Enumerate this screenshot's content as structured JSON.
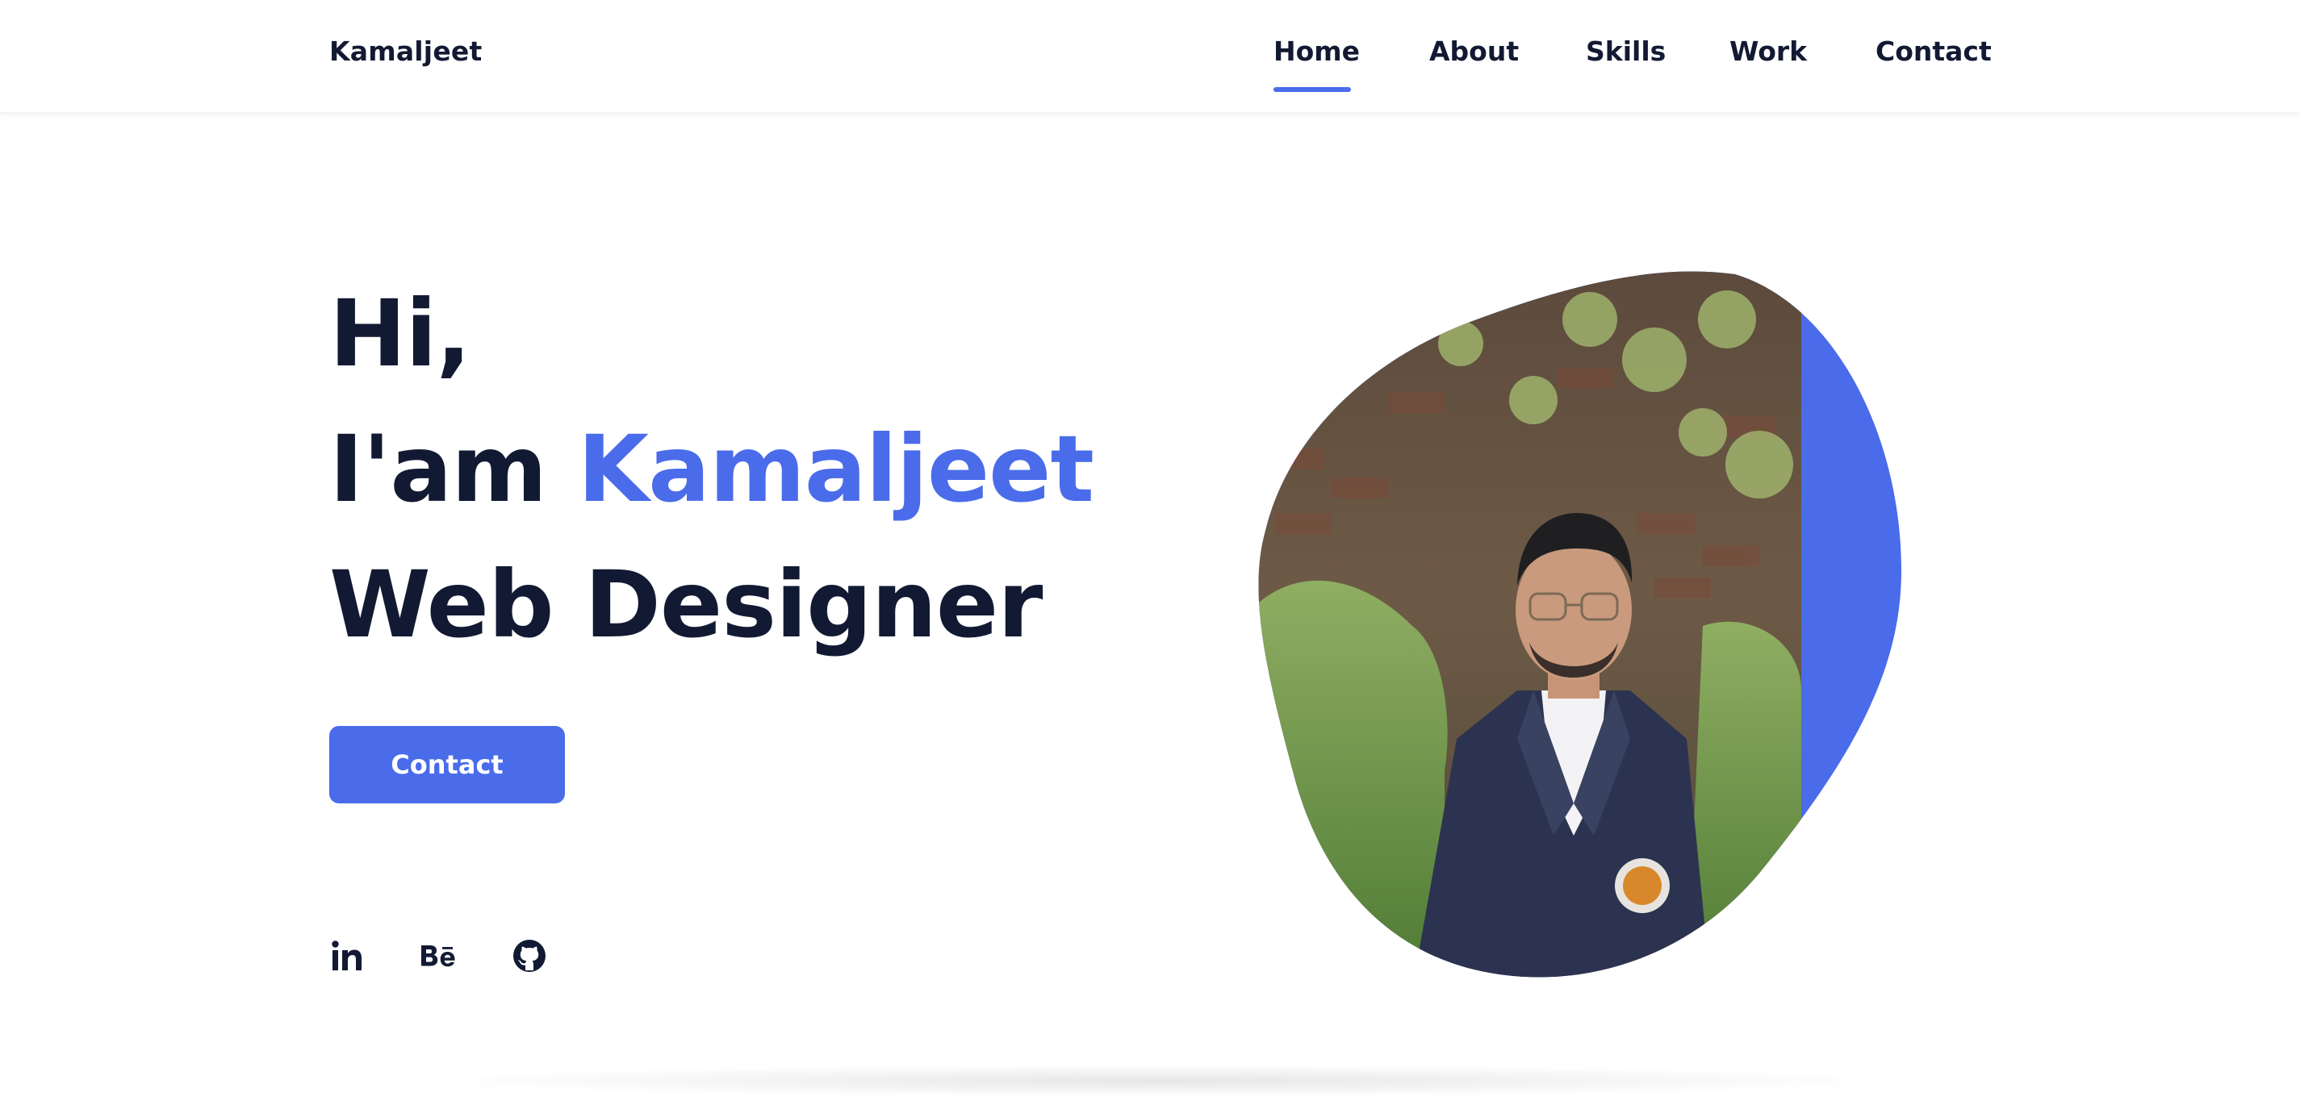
{
  "brand": {
    "name": "Kamaljeet"
  },
  "nav": {
    "items": [
      {
        "label": "Home",
        "active": true
      },
      {
        "label": "About",
        "active": false
      },
      {
        "label": "Skills",
        "active": false
      },
      {
        "label": "Work",
        "active": false
      },
      {
        "label": "Contact",
        "active": false
      }
    ]
  },
  "hero": {
    "greeting": "Hi,",
    "intro_prefix": "I'am ",
    "name": "Kamaljeet",
    "role": "Web Designer",
    "cta_label": "Contact"
  },
  "socials": [
    {
      "icon": "linkedin-icon",
      "label": "in"
    },
    {
      "icon": "behance-icon",
      "label": "Bē"
    },
    {
      "icon": "github-icon"
    }
  ],
  "colors": {
    "accent": "#4a6cea",
    "text": "#121a33",
    "background": "#ffffff"
  }
}
